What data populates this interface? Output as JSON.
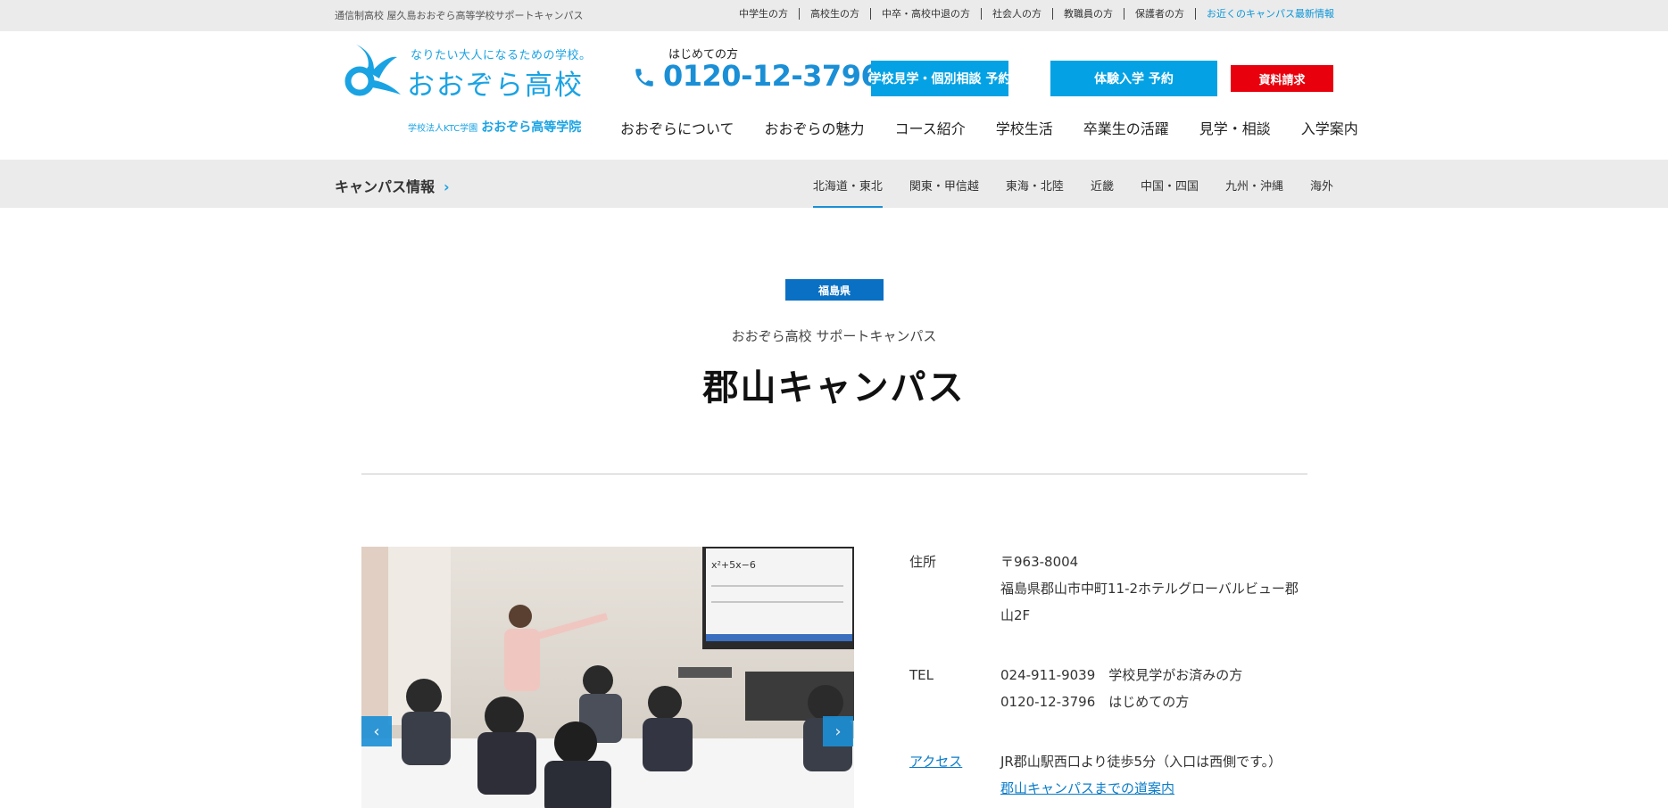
{
  "topbar": {
    "tagline": "通信制高校 屋久島おおぞら高等学校サポートキャンパス",
    "links": [
      "中学生の方",
      "高校生の方",
      "中卒・高校中退の方",
      "社会人の方",
      "教職員の方",
      "保護者の方"
    ],
    "highlight_link": "お近くのキャンパス最新情報"
  },
  "header": {
    "logo_catch": "なりたい大人になるための学校。",
    "logo_name": "おおぞら高校",
    "logo_corp_small": "学校法人KTC学園",
    "logo_corp_name": "おおぞら高等学院",
    "phone_label": "はじめての方",
    "phone_number": "0120-12-3796",
    "cta_visit": "学校見学・個別相談 予約",
    "cta_trial": "体験入学 予約",
    "cta_docs": "資料請求",
    "nav": [
      "おおぞらについて",
      "おおぞらの魅力",
      "コース紹介",
      "学校生活",
      "卒業生の活躍",
      "見学・相談",
      "入学案内"
    ]
  },
  "campus_bar": {
    "title": "キャンパス情報",
    "chevron": "›",
    "regions": [
      "北海道・東北",
      "関東・甲信越",
      "東海・北陸",
      "近畿",
      "中国・四国",
      "九州・沖縄",
      "海外"
    ],
    "active_region": "北海道・東北"
  },
  "hero": {
    "prefecture": "福島県",
    "subtitle": "おおぞら高校 サポートキャンパス",
    "title": "郡山キャンパス"
  },
  "slider": {
    "prev": "‹",
    "next": "›"
  },
  "info": {
    "address_label": "住所",
    "postal": "〒963-8004",
    "address": "福島県郡山市中町11-2ホテルグローバルビュー郡山2F",
    "tel_label": "TEL",
    "tel1": "024-911-9039　学校見学がお済みの方",
    "tel2": "0120-12-3796　はじめての方",
    "access_label": "アクセス",
    "access_text": "JR郡山駅西口より徒歩5分（入口は西側です。）",
    "directions_link": "郡山キャンパスまでの道案内"
  },
  "colors": {
    "brand_blue": "#1aa3e3",
    "cta_blue": "#04a2e4",
    "docs_red": "#e8000c",
    "pref_blue": "#0a70c3"
  }
}
